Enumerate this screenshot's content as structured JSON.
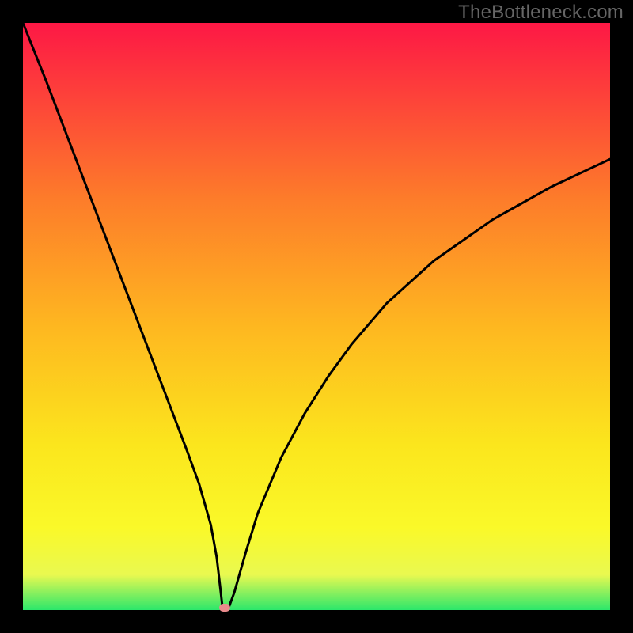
{
  "watermark": "TheBottleneck.com",
  "colors": {
    "background": "#000000",
    "gradient_top": "#fd1845",
    "gradient_mid1": "#fd7c2a",
    "gradient_mid2": "#feb820",
    "gradient_mid3": "#fbe61d",
    "gradient_mid4": "#faf929",
    "gradient_mid5": "#e9f950",
    "gradient_bottom": "#2ce76b",
    "curve_stroke": "#000000",
    "marker": "#e98a8c"
  },
  "chart_data": {
    "type": "line",
    "title": "",
    "xlabel": "",
    "ylabel": "",
    "xlim": [
      0,
      100
    ],
    "ylim": [
      0,
      100
    ],
    "series": [
      {
        "name": "bottleneck-curve",
        "x": [
          0,
          4,
          8,
          12,
          16,
          20,
          24,
          28,
          30,
          32,
          33,
          33.7,
          34,
          35,
          36,
          38,
          40,
          44,
          48,
          52,
          56,
          62,
          70,
          80,
          90,
          100
        ],
        "y": [
          100,
          90,
          79.5,
          69,
          58.5,
          48,
          37.5,
          27,
          21.5,
          14.5,
          9,
          3,
          0.3,
          0.3,
          3,
          10,
          16.5,
          26,
          33.5,
          39.8,
          45.3,
          52.3,
          59.5,
          66.5,
          72.1,
          76.8
        ]
      }
    ],
    "annotations": [
      {
        "name": "sweet-spot-marker",
        "x": 34.3,
        "y": 0.4
      }
    ]
  }
}
